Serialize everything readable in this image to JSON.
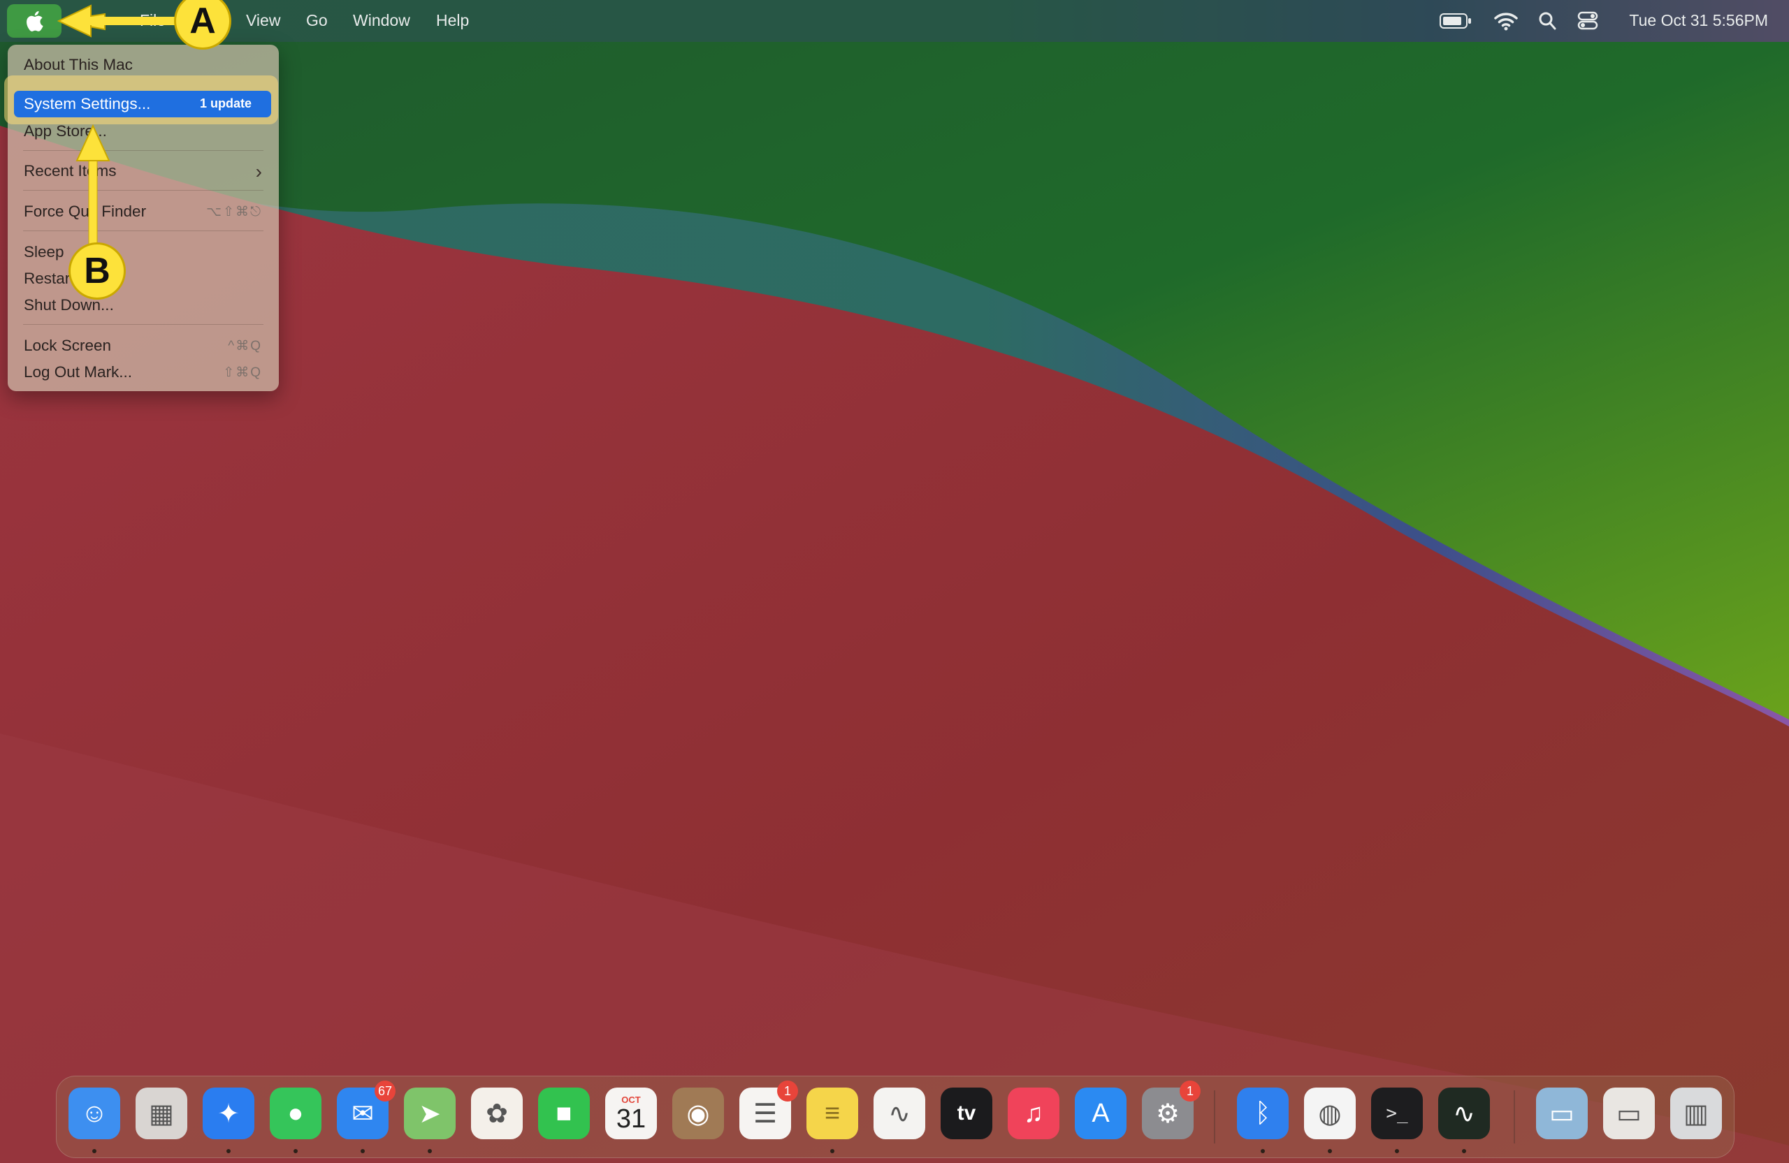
{
  "menubar": {
    "apple_label": "",
    "menus": [
      "File",
      "View",
      "Go",
      "Window",
      "Help"
    ],
    "clock": "Tue Oct 31  5:56PM",
    "status_icons": [
      "battery-icon",
      "wifi-icon",
      "spotlight-search-icon",
      "control-center-icon"
    ]
  },
  "apple_menu": {
    "items": {
      "about": "About This Mac",
      "settings": "System Settings...",
      "settings_badge": "1 update",
      "app_store": "App Store...",
      "recent_items": "Recent Items",
      "force_quit": "Force Quit Finder",
      "force_quit_shortcut": "⌥⇧⌘⎋",
      "sleep": "Sleep",
      "restart": "Restart...",
      "shut_down": "Shut Down...",
      "lock_screen": "Lock Screen",
      "lock_screen_shortcut": "^⌘Q",
      "log_out": "Log Out Mark...",
      "log_out_shortcut": "⇧⌘Q"
    }
  },
  "annotations": {
    "a": "A",
    "b": "B"
  },
  "dock": {
    "apps": [
      {
        "name": "Finder",
        "icon": "finder-icon",
        "color": "#3d8ff0",
        "running": true
      },
      {
        "name": "Launchpad",
        "icon": "launchpad-icon",
        "color": "#d9d5d2",
        "running": false
      },
      {
        "name": "Safari",
        "icon": "safari-icon",
        "color": "#2a7df0",
        "running": true
      },
      {
        "name": "Messages",
        "icon": "messages-icon",
        "color": "#35c55a",
        "running": true
      },
      {
        "name": "Mail",
        "icon": "mail-icon",
        "color": "#2f86f0",
        "running": true,
        "badge": "67"
      },
      {
        "name": "Maps",
        "icon": "maps-icon",
        "color": "#7fc46a",
        "running": true
      },
      {
        "name": "Photos",
        "icon": "photos-icon",
        "color": "#f4f0ea",
        "running": false
      },
      {
        "name": "FaceTime",
        "icon": "facetime-icon",
        "color": "#32c24f",
        "running": false
      },
      {
        "name": "Calendar",
        "icon": "calendar-icon",
        "color": "#f6f4f2",
        "running": false,
        "month": "OCT",
        "day": "31"
      },
      {
        "name": "Contacts",
        "icon": "contacts-icon",
        "color": "#a07a55",
        "running": false
      },
      {
        "name": "Reminders",
        "icon": "reminders-icon",
        "color": "#f6f4f2",
        "running": false,
        "badge": "1"
      },
      {
        "name": "Notes",
        "icon": "notes-icon",
        "color": "#f5d54a",
        "running": true
      },
      {
        "name": "Freeform",
        "icon": "freeform-icon",
        "color": "#f4f3f1",
        "running": false
      },
      {
        "name": "Apple TV",
        "icon": "appletv-icon",
        "color": "#1b1b1d",
        "running": false,
        "label": "tv"
      },
      {
        "name": "Music",
        "icon": "music-icon",
        "color": "#f0435a",
        "running": false
      },
      {
        "name": "App Store",
        "icon": "appstore-icon",
        "color": "#2b8af2",
        "running": false
      },
      {
        "name": "System Settings",
        "icon": "system-settings-icon",
        "color": "#8c8c90",
        "running": false,
        "badge": "1"
      },
      {
        "name": "Bluetooth",
        "icon": "bluetooth-icon",
        "color": "#2f80ee",
        "running": true
      },
      {
        "name": "Chrome",
        "icon": "chrome-icon",
        "color": "#f4f4f4",
        "running": true
      },
      {
        "name": "Terminal",
        "icon": "terminal-icon",
        "color": "#1d1d1f",
        "running": true
      },
      {
        "name": "Activity Monitor",
        "icon": "activity-monitor-icon",
        "color": "#1f2a22",
        "running": true
      },
      {
        "name": "Downloads",
        "icon": "downloads-stack-icon",
        "color": "#8fb7d8",
        "running": false
      },
      {
        "name": "Documents",
        "icon": "documents-stack-icon",
        "color": "#e9e6e2",
        "running": false
      },
      {
        "name": "Trash",
        "icon": "trash-icon",
        "color": "#d9dadc",
        "running": false
      }
    ]
  }
}
